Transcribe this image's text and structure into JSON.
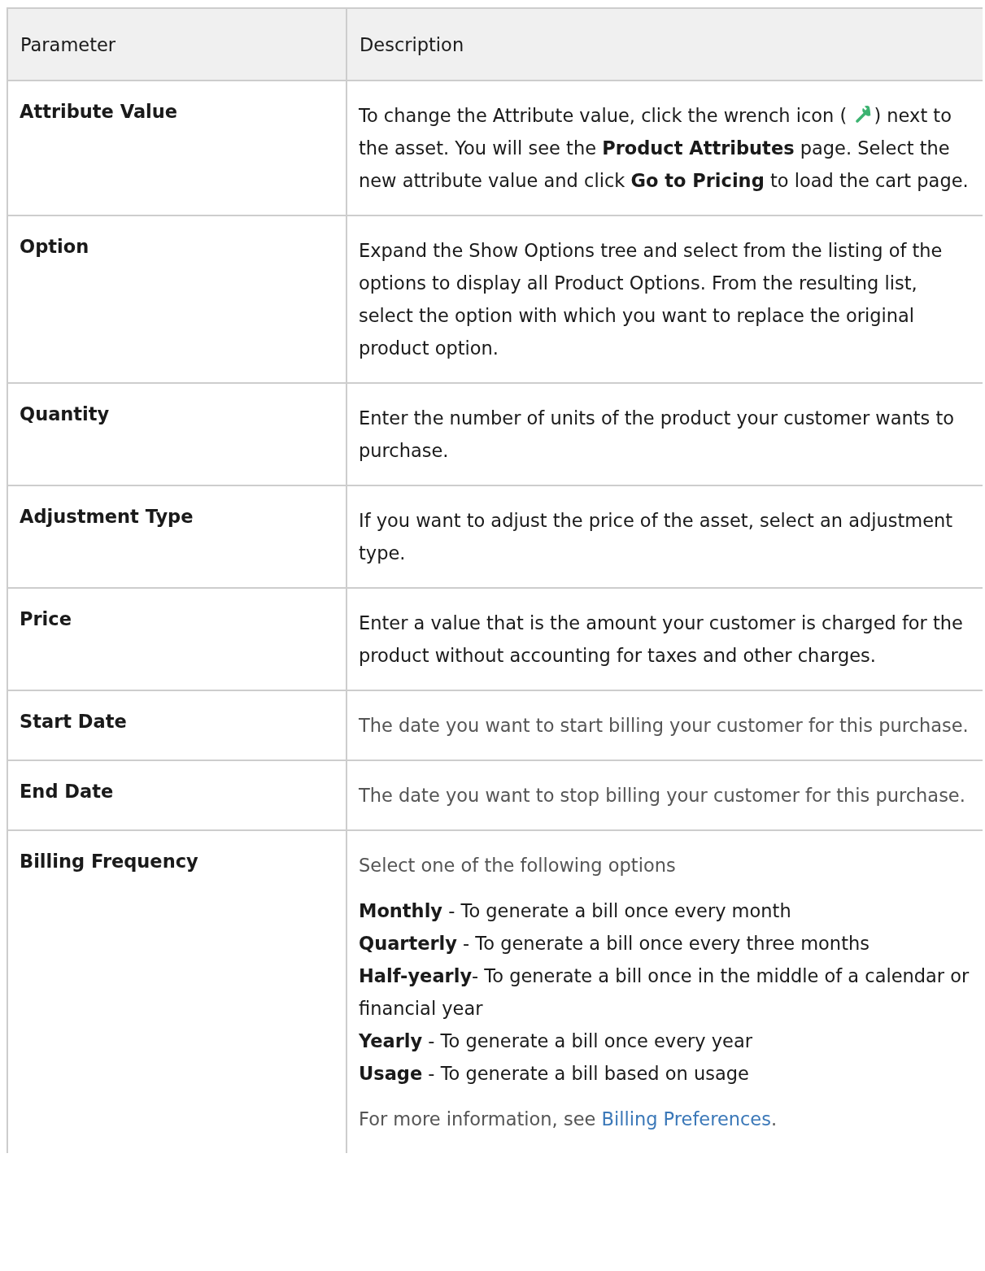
{
  "table": {
    "columns": [
      "Parameter",
      "Description"
    ],
    "rows": [
      {
        "parameter": "Attribute Value",
        "paragraphs": [
          {
            "kind": "segments",
            "muted": false,
            "segments": [
              {
                "kind": "text",
                "text": "To change the Attribute value, click the wrench icon ( "
              },
              {
                "kind": "wrench"
              },
              {
                "kind": "text",
                "text": ") next to the asset. You will see the **Product Attributes** page. Select the new attribute value and click **Go to Pricing** to load the cart page."
              }
            ]
          }
        ]
      },
      {
        "parameter": "Option",
        "paragraphs": [
          {
            "kind": "text",
            "muted": false,
            "text": "Expand the Show Options tree and select from the listing of the options to display all Product Options. From the resulting list, select the option with which you want to replace the original product option."
          }
        ]
      },
      {
        "parameter": "Quantity",
        "paragraphs": [
          {
            "kind": "text",
            "muted": false,
            "text": "Enter the number of units of the product your customer wants to purchase."
          }
        ]
      },
      {
        "parameter": "Adjustment Type",
        "paragraphs": [
          {
            "kind": "text",
            "muted": false,
            "text": "If you want to adjust the price of the asset, select an adjustment type."
          }
        ]
      },
      {
        "parameter": "Price",
        "paragraphs": [
          {
            "kind": "text",
            "muted": false,
            "text": "Enter a value that is the amount your customer is charged for the product without accounting for taxes and other charges."
          }
        ]
      },
      {
        "parameter": "Start Date",
        "paragraphs": [
          {
            "kind": "text",
            "muted": true,
            "text": "The date you want to start billing your customer for this purchase."
          }
        ]
      },
      {
        "parameter": "End Date",
        "paragraphs": [
          {
            "kind": "text",
            "muted": true,
            "text": "The date you want to stop billing your customer for this purchase."
          }
        ]
      },
      {
        "parameter": "Billing Frequency",
        "paragraphs": [
          {
            "kind": "text",
            "muted": true,
            "text": "Select one of the following options"
          },
          {
            "kind": "lines",
            "muted": false,
            "lines": [
              "**Monthly** - To generate a bill once every month",
              "**Quarterly** - To generate a bill once every three months",
              "**Half-yearly**- To generate a bill once in the middle of a calendar or financial year",
              "**Yearly** - To generate a bill once every year",
              "**Usage** -  To generate a bill based on usage"
            ]
          },
          {
            "kind": "segments",
            "muted": true,
            "segments": [
              {
                "kind": "text",
                "text": "For more information, see "
              },
              {
                "kind": "link",
                "text": "Billing Preferences"
              },
              {
                "kind": "text",
                "text": "."
              }
            ]
          }
        ]
      }
    ]
  }
}
